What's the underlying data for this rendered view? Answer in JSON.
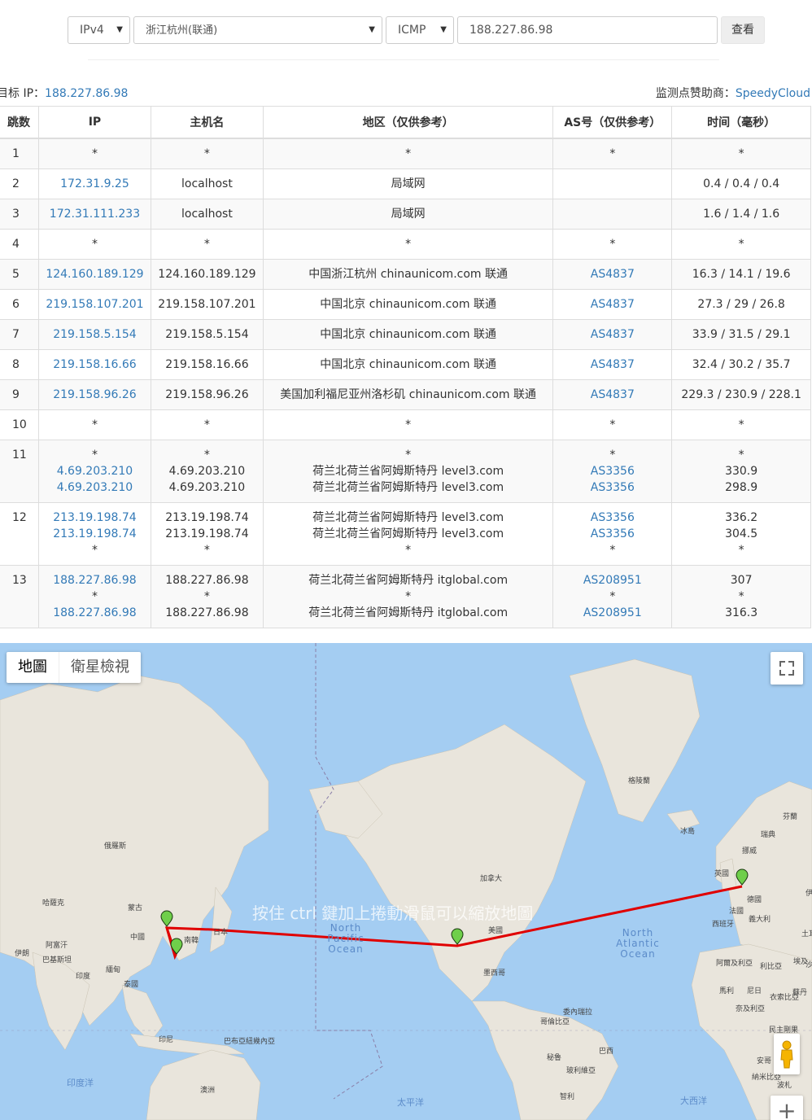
{
  "search": {
    "ip_version": "IPv4",
    "location": "浙江杭州(联通)",
    "protocol": "ICMP",
    "target_value": "188.227.86.98",
    "submit_label": "查看"
  },
  "info": {
    "target_label": "目标 IP：",
    "target_ip": "188.227.86.98",
    "sponsor_label": "监测点赞助商：",
    "sponsor_name": "SpeedyCloud"
  },
  "table": {
    "headers": [
      "跳数",
      "IP",
      "主机名",
      "地区（仅供参考）",
      "AS号（仅供参考）",
      "时间（毫秒）"
    ],
    "rows": [
      {
        "hop": "1",
        "ip": [
          "*"
        ],
        "host": [
          "*"
        ],
        "region": [
          "*"
        ],
        "as": [
          "*"
        ],
        "time": [
          "*"
        ]
      },
      {
        "hop": "2",
        "ip": [
          "172.31.9.25"
        ],
        "host": [
          "localhost"
        ],
        "region": [
          "局域网"
        ],
        "as": [
          ""
        ],
        "time": [
          "0.4 / 0.4 / 0.4"
        ]
      },
      {
        "hop": "3",
        "ip": [
          "172.31.111.233"
        ],
        "host": [
          "localhost"
        ],
        "region": [
          "局域网"
        ],
        "as": [
          ""
        ],
        "time": [
          "1.6 / 1.4 / 1.6"
        ]
      },
      {
        "hop": "4",
        "ip": [
          "*"
        ],
        "host": [
          "*"
        ],
        "region": [
          "*"
        ],
        "as": [
          "*"
        ],
        "time": [
          "*"
        ]
      },
      {
        "hop": "5",
        "ip": [
          "124.160.189.129"
        ],
        "host": [
          "124.160.189.129"
        ],
        "region": [
          "中国浙江杭州 chinaunicom.com 联通"
        ],
        "as": [
          "AS4837"
        ],
        "time": [
          "16.3 / 14.1 / 19.6"
        ]
      },
      {
        "hop": "6",
        "ip": [
          "219.158.107.201"
        ],
        "host": [
          "219.158.107.201"
        ],
        "region": [
          "中国北京 chinaunicom.com 联通"
        ],
        "as": [
          "AS4837"
        ],
        "time": [
          "27.3 / 29 / 26.8"
        ]
      },
      {
        "hop": "7",
        "ip": [
          "219.158.5.154"
        ],
        "host": [
          "219.158.5.154"
        ],
        "region": [
          "中国北京 chinaunicom.com 联通"
        ],
        "as": [
          "AS4837"
        ],
        "time": [
          "33.9 / 31.5 / 29.1"
        ]
      },
      {
        "hop": "8",
        "ip": [
          "219.158.16.66"
        ],
        "host": [
          "219.158.16.66"
        ],
        "region": [
          "中国北京 chinaunicom.com 联通"
        ],
        "as": [
          "AS4837"
        ],
        "time": [
          "32.4 / 30.2 / 35.7"
        ]
      },
      {
        "hop": "9",
        "ip": [
          "219.158.96.26"
        ],
        "host": [
          "219.158.96.26"
        ],
        "region": [
          "美国加利福尼亚州洛杉矶 chinaunicom.com 联通"
        ],
        "as": [
          "AS4837"
        ],
        "time": [
          "229.3 / 230.9 / 228.1"
        ]
      },
      {
        "hop": "10",
        "ip": [
          "*"
        ],
        "host": [
          "*"
        ],
        "region": [
          "*"
        ],
        "as": [
          "*"
        ],
        "time": [
          "*"
        ]
      },
      {
        "hop": "11",
        "ip": [
          "*",
          "4.69.203.210",
          "4.69.203.210"
        ],
        "host": [
          "*",
          "4.69.203.210",
          "4.69.203.210"
        ],
        "region": [
          "*",
          "荷兰北荷兰省阿姆斯特丹 level3.com",
          "荷兰北荷兰省阿姆斯特丹 level3.com"
        ],
        "as": [
          "*",
          "AS3356",
          "AS3356"
        ],
        "time": [
          "*",
          "330.9",
          "298.9"
        ]
      },
      {
        "hop": "12",
        "ip": [
          "213.19.198.74",
          "213.19.198.74",
          "*"
        ],
        "host": [
          "213.19.198.74",
          "213.19.198.74",
          "*"
        ],
        "region": [
          "荷兰北荷兰省阿姆斯特丹 level3.com",
          "荷兰北荷兰省阿姆斯特丹 level3.com",
          "*"
        ],
        "as": [
          "AS3356",
          "AS3356",
          "*"
        ],
        "time": [
          "336.2",
          "304.5",
          "*"
        ]
      },
      {
        "hop": "13",
        "ip": [
          "188.227.86.98",
          "*",
          "188.227.86.98"
        ],
        "host": [
          "188.227.86.98",
          "*",
          "188.227.86.98"
        ],
        "region": [
          "荷兰北荷兰省阿姆斯特丹 itglobal.com",
          "*",
          "荷兰北荷兰省阿姆斯特丹 itglobal.com"
        ],
        "as": [
          "AS208951",
          "*",
          "AS208951"
        ],
        "time": [
          "307",
          "*",
          "316.3"
        ]
      }
    ]
  },
  "map": {
    "type_map": "地圖",
    "type_satellite": "衛星檢視",
    "hint": "按住 ctrl 鍵加上捲動滑鼠可以縮放地圖",
    "zoom_in": "+",
    "route_color": "#e00000",
    "land_color": "#e9e5dc",
    "water_color": "#a4cdf2",
    "labels": [
      "格陵蘭",
      "冰島",
      "挪威",
      "芬蘭",
      "瑞典",
      "英國",
      "德國",
      "法國",
      "義大利",
      "西班牙",
      "土耳",
      "俄羅斯",
      "哈薩克",
      "蒙古",
      "中國",
      "日本",
      "南韓",
      "巴基斯坦",
      "阿富汗",
      "伊朗",
      "印度",
      "泰國",
      "印尼",
      "巴布亞紐幾內亞",
      "澳洲",
      "加拿大",
      "美國",
      "墨西哥",
      "委內瑞拉",
      "哥倫比亞",
      "秘魯",
      "玻利維亞",
      "巴西",
      "智利",
      "阿爾及利亞",
      "利比亞",
      "埃及",
      "馬利",
      "尼日",
      "蘇丹",
      "奈及利亞",
      "衣索比亞",
      "民主剛果",
      "安哥",
      "納米比亞",
      "波札",
      "沙烏地阿",
      "伊拉克",
      "緬甸"
    ],
    "oceans": [
      "North Pacific Ocean",
      "North Atlantic Ocean"
    ],
    "oceans_cn": [
      "印度洋",
      "太平洋",
      "大西洋"
    ]
  }
}
